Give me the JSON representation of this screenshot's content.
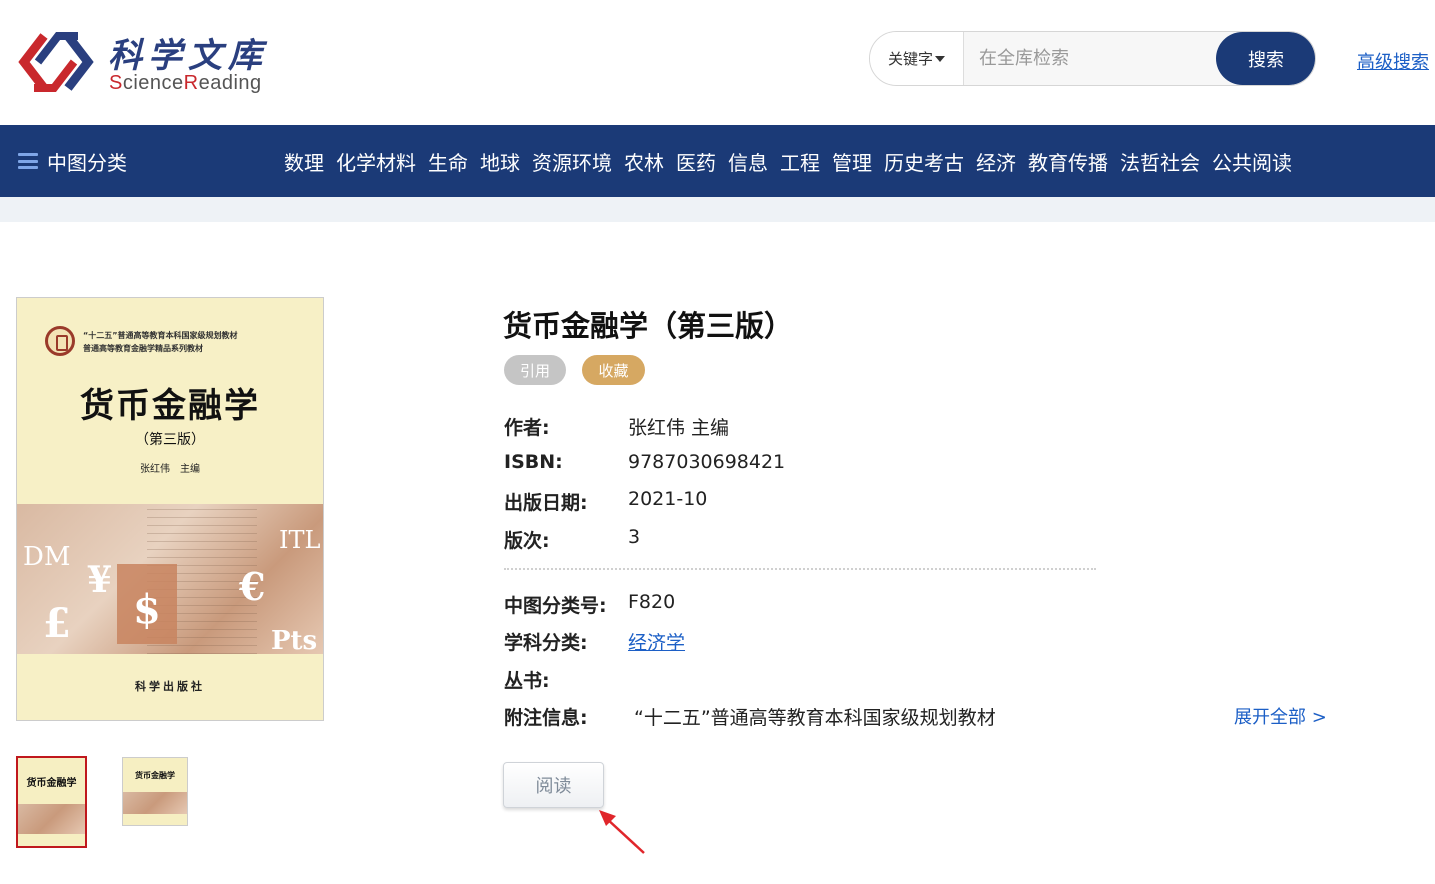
{
  "header": {
    "logo_cn": "科学文库",
    "logo_en_prefix": "S",
    "logo_en_mid1": "cience",
    "logo_en_r": "R",
    "logo_en_suffix": "eading",
    "search_type": "关键字",
    "search_placeholder": "在全库检索",
    "search_button": "搜索",
    "advanced_search": "高级搜索"
  },
  "nav": {
    "category_label": "中图分类",
    "items": [
      "数理",
      "化学材料",
      "生命",
      "地球",
      "资源环境",
      "农林",
      "医药",
      "信息",
      "工程",
      "管理",
      "历史考古",
      "经济",
      "教育传播",
      "法哲社会",
      "公共阅读"
    ]
  },
  "cover": {
    "series_line1": "“十二五”普通高等教育本科国家级规划教材",
    "series_line2": "普通高等教育金融学精品系列教材",
    "title": "货币金融学",
    "edition": "（第三版）",
    "author": "张红伟　主编",
    "publisher": "科学出版社",
    "symbols": [
      "DM",
      "¥",
      "$",
      "£",
      "€",
      "ITL",
      "Pts"
    ]
  },
  "book": {
    "title": "货币金融学（第三版）",
    "cite_label": "引用",
    "favorite_label": "收藏",
    "fields": {
      "author_label": "作者:",
      "author_value": "张红伟 主编",
      "isbn_label": "ISBN:",
      "isbn_value": "9787030698421",
      "pubdate_label": "出版日期:",
      "pubdate_value": "2021-10",
      "edition_label": "版次:",
      "edition_value": "3",
      "clc_label": "中图分类号:",
      "clc_value": "F820",
      "subject_label": "学科分类:",
      "subject_value": "经济学",
      "series_label": "丛书:",
      "series_value": "",
      "note_label": "附注信息:",
      "note_value": "“十二五”普通高等教育本科国家级规划教材"
    },
    "expand_all": "展开全部 >",
    "read_button": "阅读"
  },
  "colors": {
    "nav_bg": "#1b3a77",
    "link": "#1c5fc6",
    "favorite_tag": "#d6a862",
    "cite_tag": "#c5c5c5",
    "arrow": "#e0262b"
  }
}
